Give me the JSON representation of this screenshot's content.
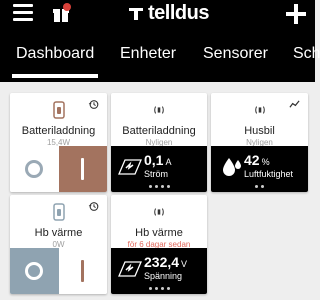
{
  "header": {
    "brand": "telldus",
    "tabs": [
      {
        "label": "Dashboard",
        "active": true
      },
      {
        "label": "Enheter"
      },
      {
        "label": "Sensorer"
      },
      {
        "label": "Sch"
      }
    ]
  },
  "cards": [
    {
      "title": "Batteriladdning",
      "sub": "15,4W",
      "icon": "plug-device-icon",
      "corner": "history-icon",
      "type": "switch",
      "state": "on"
    },
    {
      "title": "Batteriladdning",
      "sub": "Nyligen",
      "icon": "wireless-sensor-icon",
      "type": "sensor",
      "value": "0,1",
      "unit": "A",
      "label": "Ström",
      "sensor_icon": "meter-icon"
    },
    {
      "title": "Husbil",
      "sub": "Nyligen",
      "icon": "wireless-sensor-icon",
      "corner": "trend-icon",
      "type": "sensor",
      "value": "42",
      "unit": "%",
      "label": "Luftfuktighet",
      "sensor_icon": "droplets-icon"
    },
    {
      "title": "Hb värme",
      "sub": "0W",
      "icon": "plug-device-icon",
      "corner": "history-icon",
      "type": "switch",
      "state": "off"
    },
    {
      "title": "Hb värme",
      "sub": "för 6 dagar sedan",
      "sub_warn": true,
      "icon": "wireless-sensor-icon",
      "type": "sensor",
      "value": "232,4",
      "unit": "V",
      "label": "Spänning",
      "sensor_icon": "meter-icon"
    }
  ],
  "colors": {
    "on_accent": "#a3735f",
    "off_accent": "#8fa3b1",
    "topbar": "#000000",
    "warn_text": "#e0685c"
  }
}
